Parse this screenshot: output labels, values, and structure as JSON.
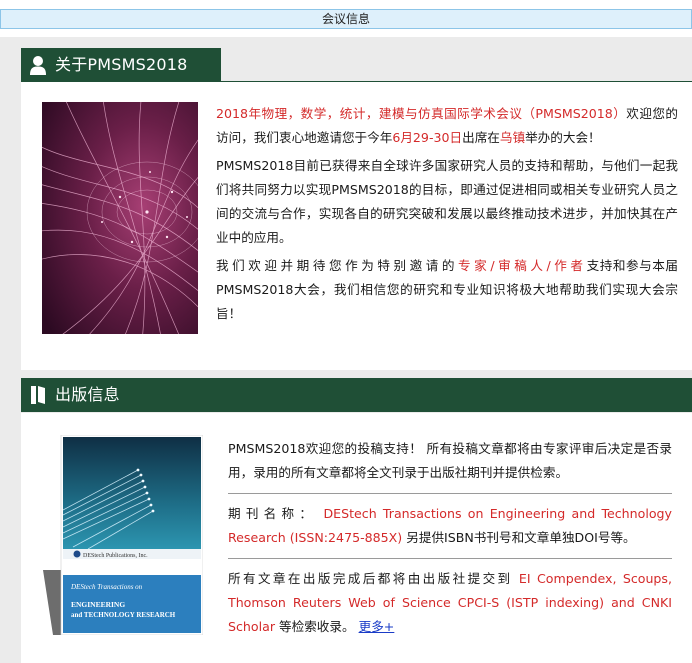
{
  "header": {
    "title": "会议信息"
  },
  "about": {
    "tab_title": "关于PMSMS2018",
    "tab_icon": "person-icon",
    "p1_red": "2018年物理，数学，统计，建模与仿真国际学术会议（PMSMS2018）",
    "p1_a": "欢迎您的访问，我们衷心地邀请您于今年",
    "p1_date": "6月29-30日",
    "p1_b": "出席在",
    "p1_place": "乌镇",
    "p1_c": "举办的大会！",
    "p2": "PMSMS2018目前已获得来自全球许多国家研究人员的支持和帮助，与他们一起我们将共同努力以实现PMSMS2018的目标，即通过促进相同或相关专业研究人员之间的交流与合作，实现各自的研究突破和发展以最终推动技术进步，并加快其在产业中的应用。",
    "p3_a": "我们欢迎并期待您作为特别邀请的",
    "p3_roles": "专家/审稿人/作者",
    "p3_b": "支持和参与本届PMSMS2018大会，我们相信您的研究和专业知识将极大地帮助我们实现大会宗旨！"
  },
  "publication": {
    "tab_title": "出版信息",
    "tab_icon": "book-icon",
    "intro": "PMSMS2018欢迎您的投稿支持！ 所有投稿文章都将由专家评审后决定是否录用，录用的所有文章都将全文刊录于出版社期刊并提供检索。",
    "journal_label": "期刊名称：",
    "journal_name": "DEStech Transactions on Engineering and Technology Research (ISSN:2475-885X)",
    "journal_tail": "另提供ISBN书刊号和文章单独DOI号等。",
    "index_a": "所有文章在出版完成后都将由出版社提交到",
    "index_db": "EI Compendex, Scoups, Thomson Reuters Web of Science CPCI-S (ISTP indexing) and CNKI Scholar",
    "index_b": "等检索收录。",
    "more_label": "更多+",
    "cover": {
      "publisher": "DEStech Publications, Inc.",
      "series": "DEStech Transactions on",
      "title_line1": "ENGINEERING",
      "title_line2": "and TECHNOLOGY RESEARCH"
    }
  },
  "colors": {
    "tab_bg": "#1f4f36",
    "highlight": "#d42a2a",
    "link": "#1a3cc7",
    "header_bg": "#def0fb"
  }
}
